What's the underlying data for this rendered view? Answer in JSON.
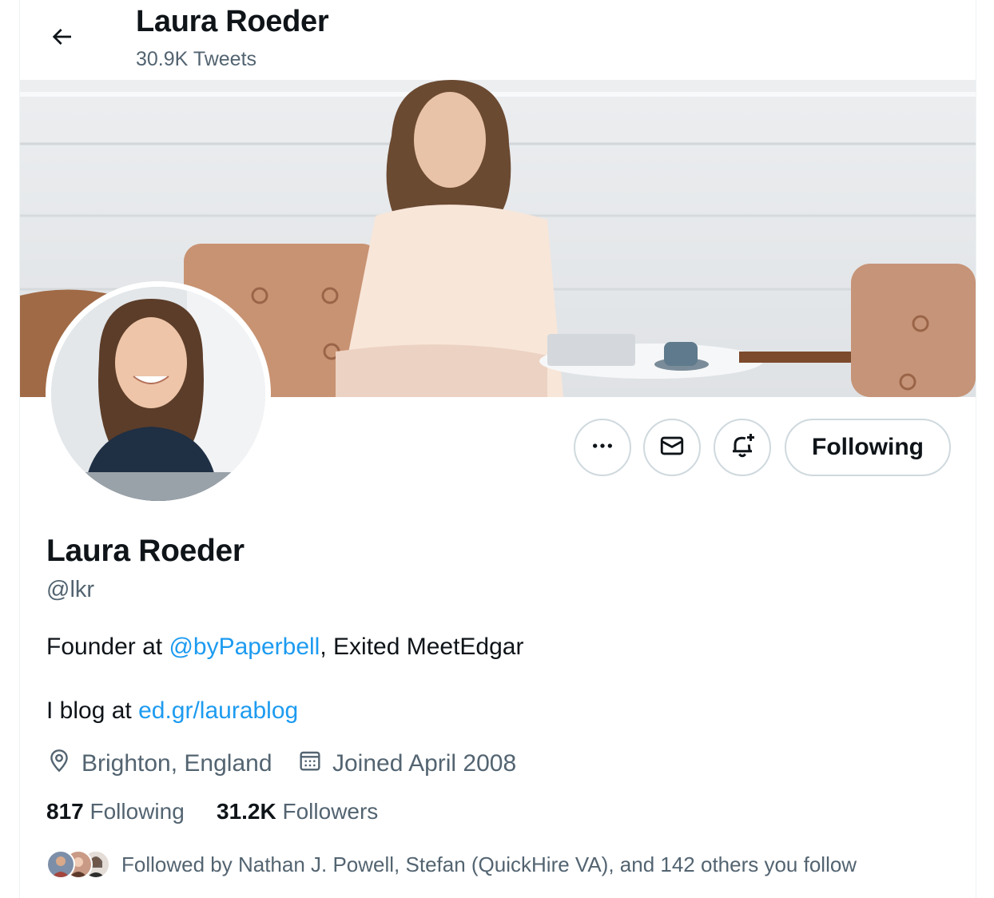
{
  "header": {
    "title": "Laura Roeder",
    "tweet_count": "30.9K Tweets"
  },
  "profile": {
    "name": "Laura Roeder",
    "handle": "@lkr",
    "bio": {
      "line1_prefix": "Founder at ",
      "line1_mention": "@byPaperbell",
      "line1_suffix": ", Exited MeetEdgar",
      "line2_prefix": "I blog at ",
      "line2_link": "ed.gr/laurablog"
    },
    "location": "Brighton, England",
    "joined": "Joined April 2008",
    "following_count": "817",
    "following_label": "Following",
    "followers_count": "31.2K",
    "followers_label": "Followers",
    "followed_by": "Followed by Nathan J. Powell, Stefan (QuickHire VA), and 142 others you follow"
  },
  "actions": {
    "following_button": "Following"
  },
  "icons": {
    "back": "arrow-left-icon",
    "more": "more-icon",
    "message": "envelope-icon",
    "notify": "bell-plus-icon",
    "location": "location-pin-icon",
    "calendar": "calendar-icon"
  },
  "colors": {
    "accent": "#1d9bf0",
    "text": "#0f1419",
    "secondary": "#536471",
    "border": "#cfd9de"
  }
}
